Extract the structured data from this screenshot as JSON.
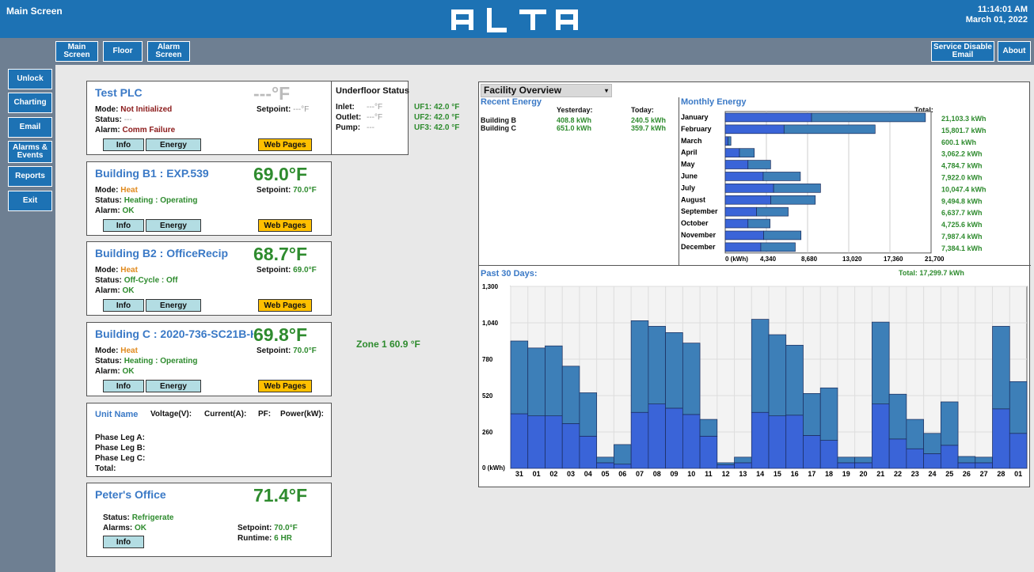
{
  "header": {
    "title": "Main Screen",
    "logo": "alta",
    "time": "11:14:01 AM",
    "date": "March 01, 2022"
  },
  "nav": {
    "main": "Main Screen",
    "floor": "Floor",
    "alarm": "Alarm Screen",
    "service": "Service Disable Email",
    "about": "About"
  },
  "sidebar": [
    "Unlock",
    "Charting",
    "Email",
    "Alarms & Events",
    "Reports",
    "Exit"
  ],
  "labels": {
    "mode": "Mode:",
    "status": "Status:",
    "alarm": "Alarm:",
    "alarms": "Alarms:",
    "setpoint": "Setpoint:",
    "info": "Info",
    "energy": "Energy",
    "web": "Web Pages",
    "runtime": "Runtime:"
  },
  "plc": {
    "name": "Test PLC",
    "temp": "---°F",
    "mode": "Not Initialized",
    "status": "---",
    "alarm": "Comm Failure",
    "setpoint": "---°F"
  },
  "underfloor": {
    "title": "Underfloor Status",
    "inlet_l": "Inlet:",
    "outlet_l": "Outlet:",
    "pump_l": "Pump:",
    "inlet": "---°F",
    "outlet": "---°F",
    "pump": "---",
    "uf1": "UF1: 42.0 °F",
    "uf2": "UF2: 42.0 °F",
    "uf3": "UF3: 42.0 °F"
  },
  "b1": {
    "name": "Building B1 : EXP.539",
    "temp": "69.0°F",
    "mode": "Heat",
    "status": "Heating : Operating",
    "alarm": "OK",
    "setpoint": "70.0°F"
  },
  "b2": {
    "name": "Building B2 : OfficeRecip",
    "temp": "68.7°F",
    "mode": "Heat",
    "status": "Off-Cycle : Off",
    "alarm": "OK",
    "setpoint": "69.0°F"
  },
  "bc": {
    "name": "Building C : 2020-736-SC21B-HT",
    "temp": "69.8°F",
    "mode": "Heat",
    "status": "Heating : Operating",
    "alarm": "OK",
    "setpoint": "70.0°F"
  },
  "zone": "Zone 1 60.9 °F",
  "power": {
    "unit": "Unit Name",
    "voltage": "Voltage(V):",
    "current": "Current(A):",
    "pf": "PF:",
    "power": "Power(kW):",
    "a": "Phase Leg A:",
    "b": "Phase Leg B:",
    "c": "Phase Leg C:",
    "total": "Total:"
  },
  "peter": {
    "name": "Peter's Office",
    "temp": "71.4°F",
    "status": "Refrigerate",
    "alarms": "OK",
    "setpoint": "70.0°F",
    "runtime": "6 HR"
  },
  "facility": {
    "select": "Facility Overview",
    "recent": "Recent Energy",
    "yesterday": "Yesterday:",
    "today": "Today:",
    "rows": [
      {
        "name": "Building B",
        "y": "408.8 kWh",
        "t": "240.5 kWh"
      },
      {
        "name": "Building C",
        "y": "651.0 kWh",
        "t": "359.7 kWh"
      }
    ],
    "monthly": "Monthly Energy",
    "total_label": "Total:",
    "past": "Past 30 Days:",
    "past_total": "Total: 17,299.7 kWh"
  },
  "chart_data": [
    {
      "type": "bar",
      "title": "Monthly Energy",
      "categories": [
        "January",
        "February",
        "March",
        "April",
        "May",
        "June",
        "July",
        "August",
        "September",
        "October",
        "November",
        "December"
      ],
      "series": [
        {
          "values": [
            9100,
            6200,
            300,
            1500,
            2400,
            4000,
            5100,
            4800,
            3300,
            2400,
            4050,
            3750
          ]
        },
        {
          "values": [
            12003.3,
            9601.7,
            300.1,
            1562.2,
            2384.7,
            3922,
            4947.4,
            4694.8,
            3337.7,
            2325.6,
            3937.4,
            3634.1
          ]
        }
      ],
      "totals": [
        "21,103.3 kWh",
        "15,801.7 kWh",
        "600.1 kWh",
        "3,062.2 kWh",
        "4,784.7 kWh",
        "7,922.0 kWh",
        "10,047.4 kWh",
        "9,494.8 kWh",
        "6,637.7 kWh",
        "4,725.6 kWh",
        "7,987.4 kWh",
        "7,384.1 kWh"
      ],
      "xticks": [
        "0 (kWh)",
        "4,340",
        "8,680",
        "13,020",
        "17,360",
        "21,700"
      ],
      "xlim": [
        0,
        21700
      ]
    },
    {
      "type": "bar",
      "title": "Past 30 Days:",
      "categories": [
        "31",
        "01",
        "02",
        "03",
        "04",
        "05",
        "06",
        "07",
        "08",
        "09",
        "10",
        "11",
        "12",
        "13",
        "14",
        "15",
        "16",
        "17",
        "18",
        "19",
        "20",
        "21",
        "22",
        "23",
        "24",
        "25",
        "26",
        "27",
        "28",
        "01"
      ],
      "series": [
        {
          "values": [
            390,
            375,
            375,
            320,
            230,
            40,
            30,
            400,
            460,
            430,
            385,
            230,
            25,
            40,
            400,
            375,
            380,
            235,
            200,
            40,
            40,
            460,
            210,
            140,
            105,
            165,
            40,
            40,
            425,
            250
          ]
        },
        {
          "values": [
            520,
            485,
            500,
            410,
            310,
            40,
            140,
            655,
            555,
            540,
            510,
            120,
            15,
            40,
            665,
            580,
            500,
            300,
            375,
            40,
            40,
            585,
            320,
            210,
            145,
            310,
            45,
            40,
            590,
            370
          ]
        }
      ],
      "yticks": [
        "0 (kWh)",
        "260",
        "520",
        "780",
        "1,040",
        "1,300"
      ],
      "ylim": [
        0,
        1300
      ]
    }
  ]
}
